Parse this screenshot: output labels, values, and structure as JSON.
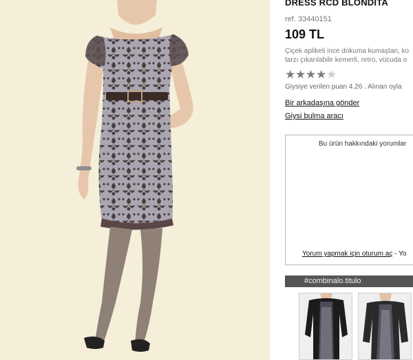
{
  "product": {
    "title": "DRESS RCD BLONDITA",
    "ref": "ref. 33440151",
    "price": "109 TL",
    "description_line1": "Çiçek aplikeli ince dokuma kumaştan, ko",
    "description_line2": "tarzı çıkarılabilir kemerli, retro, vücuda o"
  },
  "rating": {
    "value": 4.26,
    "max": 5,
    "text": "Giysiye verilen puan 4.26 . Alınan oyla"
  },
  "links": {
    "send_friend": "Bir arkadaşına gönder",
    "finder": "Giysi bulma aracı"
  },
  "comments": {
    "title": "Bu ürün hakkındaki yorumlar",
    "login_link": "Yorum yapmak için oturum aç",
    "login_suffix": " - Yo"
  },
  "combination": {
    "header": "#combinalo.titulo"
  },
  "colors": {
    "background": "#f5efd9",
    "dress_base": "#a9a6b2",
    "lace": "#4a3d3b",
    "header_bar": "#555555"
  }
}
